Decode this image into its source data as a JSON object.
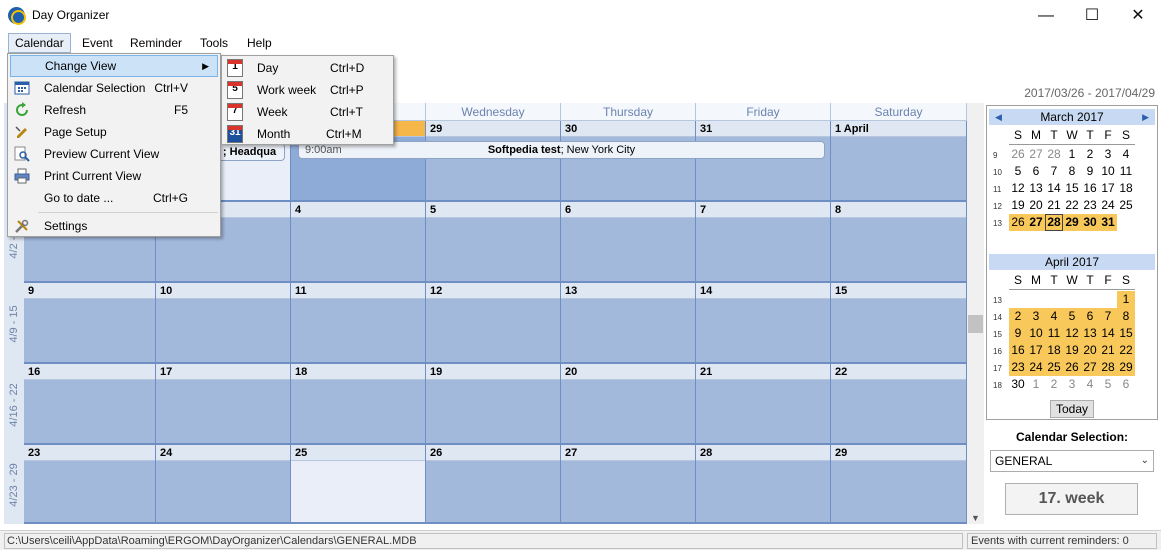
{
  "window": {
    "title": "Day Organizer",
    "minimize": "—",
    "maximize": "☐",
    "close": "✕"
  },
  "menubar": [
    "Calendar",
    "Event",
    "Reminder",
    "Tools",
    "Help"
  ],
  "calendar_menu": [
    {
      "label": "Change View",
      "shortcut": "",
      "icon": "none"
    },
    {
      "label": "Calendar Selection",
      "shortcut": "Ctrl+V",
      "icon": "calendar-grid-icon"
    },
    {
      "label": "Refresh",
      "shortcut": "F5",
      "icon": "refresh-icon"
    },
    {
      "label": "Page Setup",
      "shortcut": "",
      "icon": "page-setup-icon"
    },
    {
      "label": "Preview Current View",
      "shortcut": "",
      "icon": "magnifier-icon"
    },
    {
      "label": "Print Current View",
      "shortcut": "",
      "icon": "printer-icon"
    },
    {
      "label": "Go to date ...",
      "shortcut": "Ctrl+G",
      "icon": "none"
    },
    {
      "label": "Settings",
      "shortcut": "",
      "icon": "tools-icon"
    }
  ],
  "change_view_submenu": [
    {
      "label": "Day",
      "shortcut": "Ctrl+D",
      "icon_num": "1"
    },
    {
      "label": "Work week",
      "shortcut": "Ctrl+P",
      "icon_num": "5"
    },
    {
      "label": "Week",
      "shortcut": "Ctrl+T",
      "icon_num": "7"
    },
    {
      "label": "Month",
      "shortcut": "Ctrl+M",
      "icon_num": "31"
    }
  ],
  "date_range": "2017/03/26 - 2017/04/29",
  "day_headers": [
    "Wednesday",
    "Thursday",
    "Friday",
    "Saturday"
  ],
  "weeks": [
    {
      "label": "",
      "days": [
        "",
        "",
        "29",
        "30",
        "31",
        "1 April"
      ]
    },
    {
      "label": "4/2 - 8",
      "days": [
        "",
        "",
        "4",
        "5",
        "6",
        "7",
        "8"
      ]
    },
    {
      "label": "4/9 - 15",
      "days": [
        "9",
        "10",
        "11",
        "12",
        "13",
        "14",
        "15"
      ]
    },
    {
      "label": "4/16 - 22",
      "days": [
        "16",
        "17",
        "18",
        "19",
        "20",
        "21",
        "22"
      ]
    },
    {
      "label": "4/23 - 29",
      "days": [
        "23",
        "24",
        "25",
        "26",
        "27",
        "28",
        "29"
      ]
    }
  ],
  "events": [
    {
      "time": "",
      "title": "; Headqua"
    },
    {
      "time": "9:00am",
      "title_bold": "Softpedia test",
      "title_rest": "; New York City"
    }
  ],
  "mini_march": {
    "title": "March 2017",
    "dow": [
      "S",
      "M",
      "T",
      "W",
      "T",
      "F",
      "S"
    ],
    "weeks": [
      {
        "wk": "9",
        "days": [
          "26",
          "27",
          "28",
          "1",
          "2",
          "3",
          "4"
        ]
      },
      {
        "wk": "10",
        "days": [
          "5",
          "6",
          "7",
          "8",
          "9",
          "10",
          "11"
        ]
      },
      {
        "wk": "11",
        "days": [
          "12",
          "13",
          "14",
          "15",
          "16",
          "17",
          "18"
        ]
      },
      {
        "wk": "12",
        "days": [
          "19",
          "20",
          "21",
          "22",
          "23",
          "24",
          "25"
        ]
      },
      {
        "wk": "13",
        "days": [
          "26",
          "27",
          "28",
          "29",
          "30",
          "31",
          ""
        ]
      }
    ]
  },
  "mini_april": {
    "title": "April 2017",
    "dow": [
      "S",
      "M",
      "T",
      "W",
      "T",
      "F",
      "S"
    ],
    "weeks": [
      {
        "wk": "13",
        "days": [
          "",
          "",
          "",
          "",
          "",
          "",
          "1"
        ]
      },
      {
        "wk": "14",
        "days": [
          "2",
          "3",
          "4",
          "5",
          "6",
          "7",
          "8"
        ]
      },
      {
        "wk": "15",
        "days": [
          "9",
          "10",
          "11",
          "12",
          "13",
          "14",
          "15"
        ]
      },
      {
        "wk": "16",
        "days": [
          "16",
          "17",
          "18",
          "19",
          "20",
          "21",
          "22"
        ]
      },
      {
        "wk": "17",
        "days": [
          "23",
          "24",
          "25",
          "26",
          "27",
          "28",
          "29"
        ]
      },
      {
        "wk": "18",
        "days": [
          "30",
          "1",
          "2",
          "3",
          "4",
          "5",
          "6"
        ]
      }
    ]
  },
  "today_button": "Today",
  "calendar_selection": {
    "label": "Calendar Selection:",
    "value": "GENERAL"
  },
  "week_indicator": "17. week",
  "status": {
    "path": "C:\\Users\\ceili\\AppData\\Roaming\\ERGOM\\DayOrganizer\\Calendars\\GENERAL.MDB",
    "reminders": "Events with current reminders: 0"
  },
  "colors": {
    "cell": "#a3b9dc",
    "today": "#f5b64a",
    "selected_mini": "#f8c85a",
    "header": "#c8daf3"
  }
}
